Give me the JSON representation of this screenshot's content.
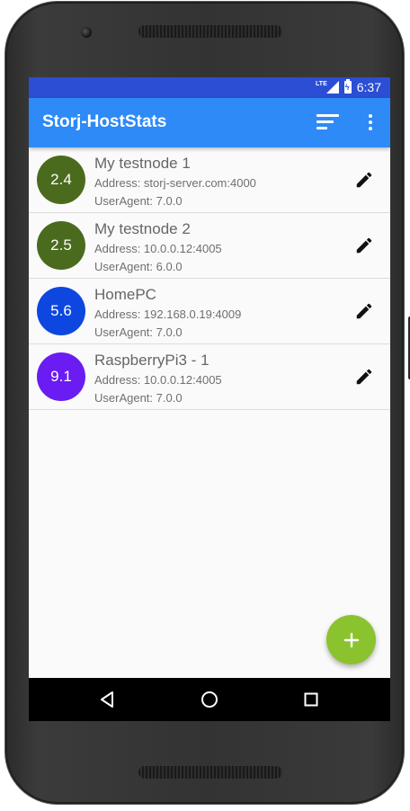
{
  "status_bar": {
    "network": "LTE",
    "time": "6:37",
    "icons": [
      "lte-icon",
      "signal-icon",
      "battery-charging-icon"
    ]
  },
  "app_bar": {
    "title": "Storj-HostStats",
    "actions": [
      "sort-icon",
      "more-vert-icon"
    ]
  },
  "nodes": [
    {
      "score": "2.4",
      "name": "My testnode 1",
      "address": "Address: storj-server.com:4000",
      "user_agent": "UserAgent: 7.0.0",
      "color": "#4a6b1e"
    },
    {
      "score": "2.5",
      "name": "My testnode 2",
      "address": "Address: 10.0.0.12:4005",
      "user_agent": "UserAgent: 6.0.0",
      "color": "#4a6b1e"
    },
    {
      "score": "5.6",
      "name": "HomePC",
      "address": "Address: 192.168.0.19:4009",
      "user_agent": "UserAgent: 7.0.0",
      "color": "#0d47e0"
    },
    {
      "score": "9.1",
      "name": "RaspberryPi3 - 1",
      "address": "Address: 10.0.0.12:4005",
      "user_agent": "UserAgent: 7.0.0",
      "color": "#6a1cf2"
    }
  ],
  "fab": {
    "icon": "add-icon",
    "color": "#8bc32e"
  },
  "colors": {
    "status_bar": "#2b4ed4",
    "app_bar": "#2d8af7",
    "background": "#fafafa"
  },
  "nav_bar": {
    "icons": [
      "back-icon",
      "home-icon",
      "recents-icon"
    ]
  }
}
